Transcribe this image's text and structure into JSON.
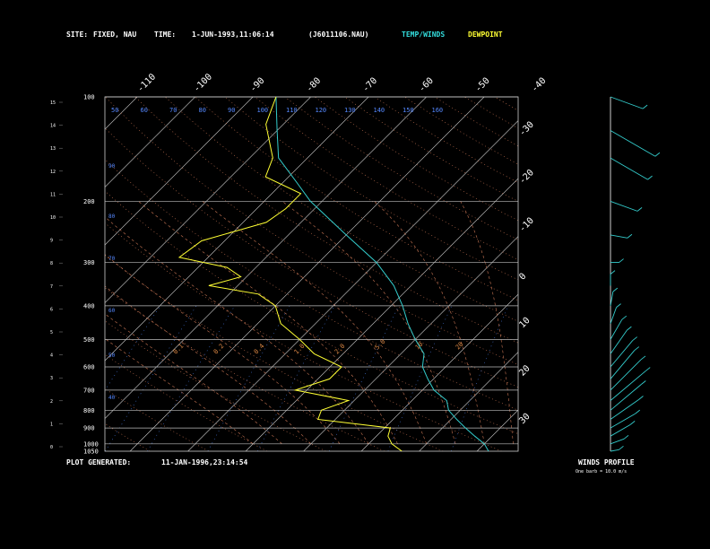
{
  "header": {
    "site_label": "SITE:",
    "site_value": "FIXED, NAU",
    "time_label": "TIME:",
    "time_value": "1-JUN-1993,11:06:14",
    "file_id": "(J6011106.NAU)",
    "legend_temp": "TEMP/WINDS",
    "legend_dew": "DEWPOINT"
  },
  "footer": {
    "generated_label": "PLOT GENERATED:",
    "generated_value": "11-JAN-1996,23:14:54"
  },
  "winds_panel": {
    "title": "WINDS PROFILE",
    "note": "One barb = 10.0 m/s"
  },
  "colors": {
    "temp": "#33cccc",
    "dewpoint": "#ffff33",
    "isobar": "#bbbbbb",
    "isotherm": "#cccccc",
    "dry_adiabat": "#cc7755",
    "moist_adiabat": "#cc7755",
    "mixing_ratio": "#4477dd",
    "label_orange": "#dd8844",
    "label_blue": "#5588ff"
  },
  "chart_data": {
    "type": "line",
    "pressure_levels_hpa": [
      100,
      200,
      300,
      400,
      500,
      600,
      700,
      800,
      900,
      1000,
      1050
    ],
    "height_km_ticks": [
      "15",
      "14",
      "13",
      "12",
      "11",
      "10",
      "9",
      "8",
      "7",
      "6",
      "5",
      "4",
      "3",
      "2",
      "1",
      "0"
    ],
    "isotherm_top_labels": [
      "-110",
      "-100",
      "-90",
      "-80",
      "-70",
      "-60",
      "-50",
      "-40"
    ],
    "isotherm_right_labels": [
      "-30",
      "-20",
      "-10",
      "0",
      "10",
      "20",
      "30"
    ],
    "mixing_ratio_labels": [
      "0.1",
      "0.2",
      "0.4",
      "1.0",
      "2.0",
      "5.0",
      "10",
      "20"
    ],
    "theta_labels": [
      "90",
      "80",
      "70",
      "60",
      "50",
      "40"
    ],
    "theta_top_labels": [
      "50",
      "60",
      "70",
      "80",
      "90",
      "100",
      "110",
      "120",
      "130",
      "140",
      "150",
      "160"
    ],
    "series": [
      {
        "name": "TEMP/WINDS",
        "points": [
          [
            1050,
            32
          ],
          [
            1000,
            30
          ],
          [
            950,
            27
          ],
          [
            900,
            24
          ],
          [
            850,
            21
          ],
          [
            800,
            18
          ],
          [
            750,
            16
          ],
          [
            700,
            12
          ],
          [
            650,
            9
          ],
          [
            600,
            6
          ],
          [
            550,
            4
          ],
          [
            500,
            0
          ],
          [
            450,
            -4
          ],
          [
            400,
            -8
          ],
          [
            350,
            -13
          ],
          [
            300,
            -20
          ],
          [
            250,
            -30
          ],
          [
            200,
            -42
          ],
          [
            175,
            -48
          ],
          [
            150,
            -55
          ],
          [
            125,
            -60
          ],
          [
            100,
            -66
          ]
        ]
      },
      {
        "name": "DEWPOINT",
        "points": [
          [
            1050,
            17
          ],
          [
            1000,
            14
          ],
          [
            950,
            12
          ],
          [
            900,
            11
          ],
          [
            850,
            -3
          ],
          [
            800,
            -4
          ],
          [
            750,
            -1
          ],
          [
            700,
            -12
          ],
          [
            650,
            -8
          ],
          [
            600,
            -8
          ],
          [
            550,
            -15
          ],
          [
            500,
            -20
          ],
          [
            450,
            -26
          ],
          [
            400,
            -30
          ],
          [
            370,
            -35
          ],
          [
            350,
            -45
          ],
          [
            330,
            -41
          ],
          [
            310,
            -45
          ],
          [
            290,
            -55
          ],
          [
            260,
            -54
          ],
          [
            230,
            -46
          ],
          [
            210,
            -45
          ],
          [
            190,
            -45
          ],
          [
            170,
            -54
          ],
          [
            150,
            -56
          ],
          [
            120,
            -63
          ],
          [
            100,
            -66
          ]
        ]
      }
    ],
    "winds": [
      {
        "p": 1050,
        "dir": 260,
        "spd": 3
      },
      {
        "p": 1000,
        "dir": 250,
        "spd": 5
      },
      {
        "p": 950,
        "dir": 240,
        "spd": 8
      },
      {
        "p": 900,
        "dir": 240,
        "spd": 10
      },
      {
        "p": 850,
        "dir": 235,
        "spd": 12
      },
      {
        "p": 800,
        "dir": 230,
        "spd": 14
      },
      {
        "p": 750,
        "dir": 230,
        "spd": 16
      },
      {
        "p": 700,
        "dir": 225,
        "spd": 15
      },
      {
        "p": 650,
        "dir": 220,
        "spd": 13
      },
      {
        "p": 600,
        "dir": 220,
        "spd": 12
      },
      {
        "p": 550,
        "dir": 215,
        "spd": 10
      },
      {
        "p": 500,
        "dir": 210,
        "spd": 8
      },
      {
        "p": 450,
        "dir": 200,
        "spd": 6
      },
      {
        "p": 400,
        "dir": 190,
        "spd": 5
      },
      {
        "p": 350,
        "dir": 180,
        "spd": 4
      },
      {
        "p": 300,
        "dir": 270,
        "spd": 3
      },
      {
        "p": 250,
        "dir": 280,
        "spd": 6
      },
      {
        "p": 200,
        "dir": 290,
        "spd": 10
      },
      {
        "p": 150,
        "dir": 300,
        "spd": 15
      },
      {
        "p": 125,
        "dir": 300,
        "spd": 18
      },
      {
        "p": 100,
        "dir": 290,
        "spd": 12
      }
    ],
    "xlim": [
      -110,
      35
    ],
    "ylim": [
      1050,
      100
    ],
    "grid": true
  }
}
